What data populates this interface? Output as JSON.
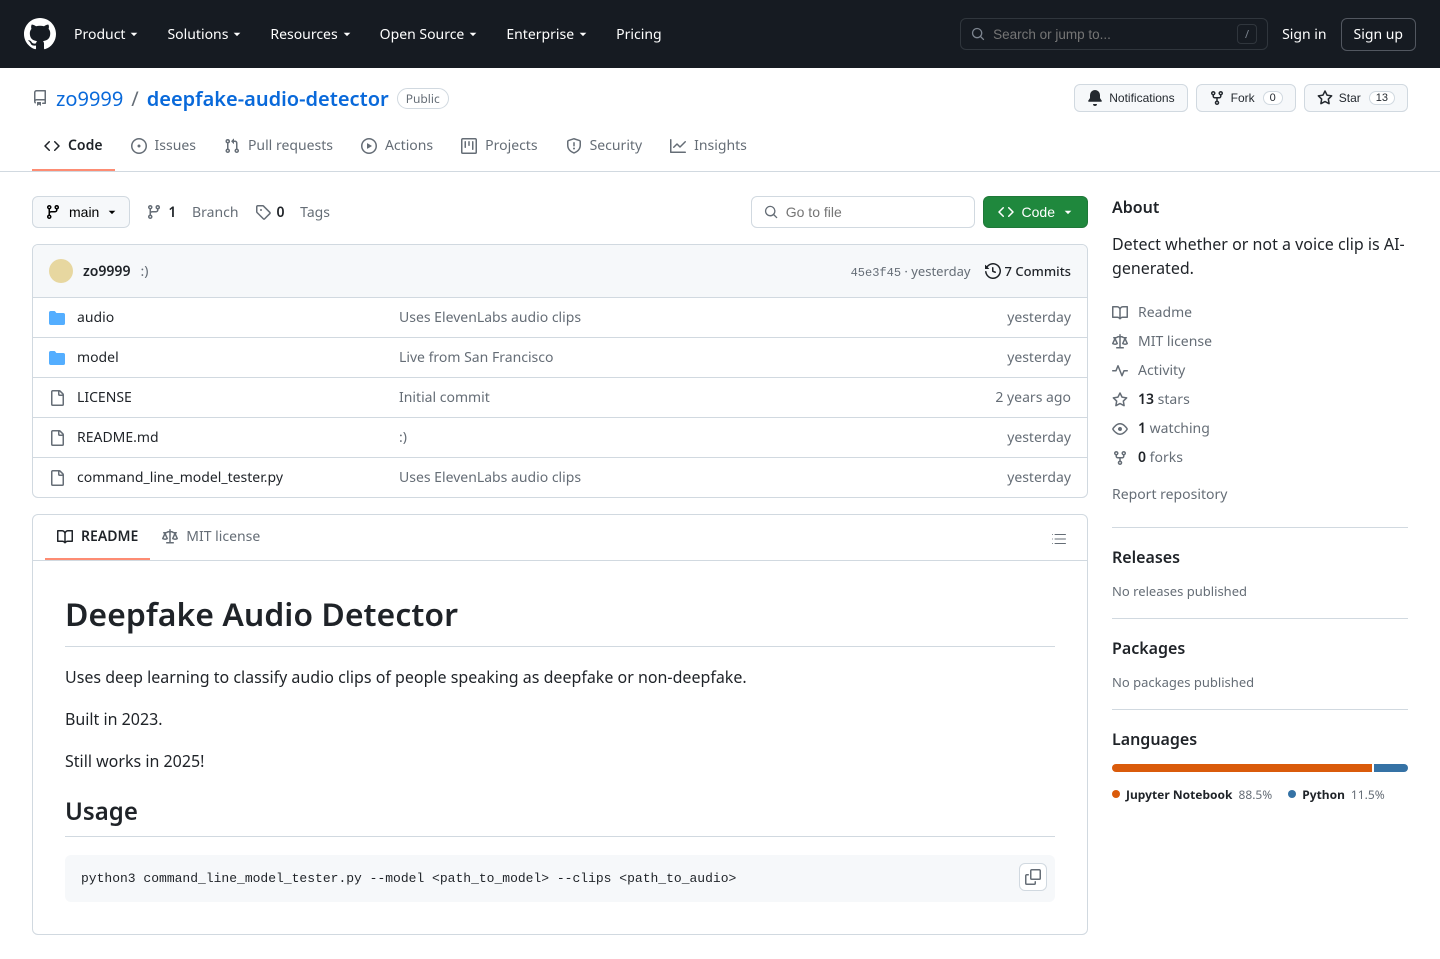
{
  "header": {
    "nav": [
      "Product",
      "Solutions",
      "Resources",
      "Open Source",
      "Enterprise",
      "Pricing"
    ],
    "search_placeholder": "Search or jump to...",
    "signin": "Sign in",
    "signup": "Sign up"
  },
  "repo": {
    "owner": "zo9999",
    "name": "deepfake-audio-detector",
    "visibility": "Public",
    "actions": {
      "notifications": "Notifications",
      "fork": "Fork",
      "fork_count": "0",
      "star": "Star",
      "star_count": "13"
    },
    "tabs": [
      "Code",
      "Issues",
      "Pull requests",
      "Actions",
      "Projects",
      "Security",
      "Insights"
    ]
  },
  "branch": {
    "current": "main",
    "branch_count": "1",
    "branch_label": "Branch",
    "tag_count": "0",
    "tag_label": "Tags",
    "goto_placeholder": "Go to file",
    "code_btn": "Code"
  },
  "commit": {
    "author": "zo9999",
    "message": ":)",
    "sha": "45e3f45",
    "time_sep": "·",
    "time": "yesterday",
    "commits_count": "7 Commits"
  },
  "files": [
    {
      "type": "folder",
      "name": "audio",
      "msg": "Uses ElevenLabs audio clips",
      "time": "yesterday"
    },
    {
      "type": "folder",
      "name": "model",
      "msg": "Live from San Francisco",
      "time": "yesterday"
    },
    {
      "type": "file",
      "name": "LICENSE",
      "msg": "Initial commit",
      "time": "2 years ago"
    },
    {
      "type": "file",
      "name": "README.md",
      "msg": ":)",
      "time": "yesterday"
    },
    {
      "type": "file",
      "name": "command_line_model_tester.py",
      "msg": "Uses ElevenLabs audio clips",
      "time": "yesterday"
    }
  ],
  "readme_tabs": {
    "readme": "README",
    "license": "MIT license"
  },
  "readme": {
    "title": "Deepfake Audio Detector",
    "p1": "Uses deep learning to classify audio clips of people speaking as deepfake or non-deepfake.",
    "p2": "Built in 2023.",
    "p3": "Still works in 2025!",
    "h2_usage": "Usage",
    "code": "python3 command_line_model_tester.py --model <path_to_model> --clips <path_to_audio>"
  },
  "sidebar": {
    "about": "About",
    "description": "Detect whether or not a voice clip is AI-generated.",
    "links": {
      "readme": "Readme",
      "license": "MIT license",
      "activity": "Activity",
      "stars_n": "13",
      "stars_t": "stars",
      "watching_n": "1",
      "watching_t": "watching",
      "forks_n": "0",
      "forks_t": "forks",
      "report": "Report repository"
    },
    "releases": {
      "title": "Releases",
      "note": "No releases published"
    },
    "packages": {
      "title": "Packages",
      "note": "No packages published"
    },
    "languages": {
      "title": "Languages",
      "items": [
        {
          "name": "Jupyter Notebook",
          "pct": "88.5%",
          "color": "#DA5B0B",
          "width": "88.5%"
        },
        {
          "name": "Python",
          "pct": "11.5%",
          "color": "#3572A5",
          "width": "11.5%"
        }
      ]
    }
  }
}
